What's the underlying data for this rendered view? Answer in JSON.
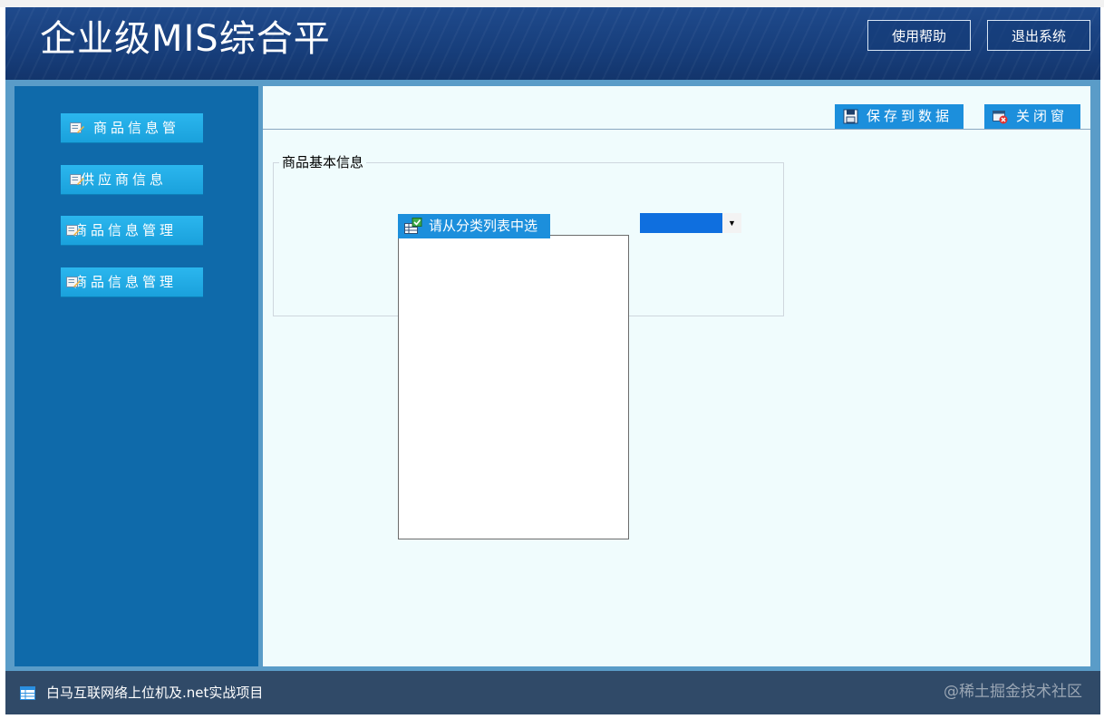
{
  "header": {
    "title": "企业级MIS综合平",
    "help_label": "使用帮助",
    "exit_label": "退出系统"
  },
  "sidebar": {
    "items": [
      {
        "label": "商品信息管",
        "icon": "edit-list-icon"
      },
      {
        "label": "供应商信息",
        "icon": "edit-list-icon"
      },
      {
        "label": "商品信息管理",
        "icon": "edit-list-icon"
      },
      {
        "label": "商品信息管理",
        "icon": "edit-list-icon"
      }
    ]
  },
  "toolbar": {
    "save_label": "保存到数据",
    "close_label": "关闭窗"
  },
  "form": {
    "group_title": "商品基本信息",
    "category_button_label": "请从分类列表中选",
    "combo_arrow": "▼"
  },
  "statusbar": {
    "text": "白马互联网络上位机及.net实战项目",
    "watermark": "@稀土掘金技术社区"
  },
  "colors": {
    "header": "#1f4a8c",
    "sidebar": "#0f6aaa",
    "sidebar_button": "#1aa1dc",
    "tool_button": "#1c8fdc",
    "content_bg": "#f0fcfd",
    "statusbar": "#304a68"
  }
}
